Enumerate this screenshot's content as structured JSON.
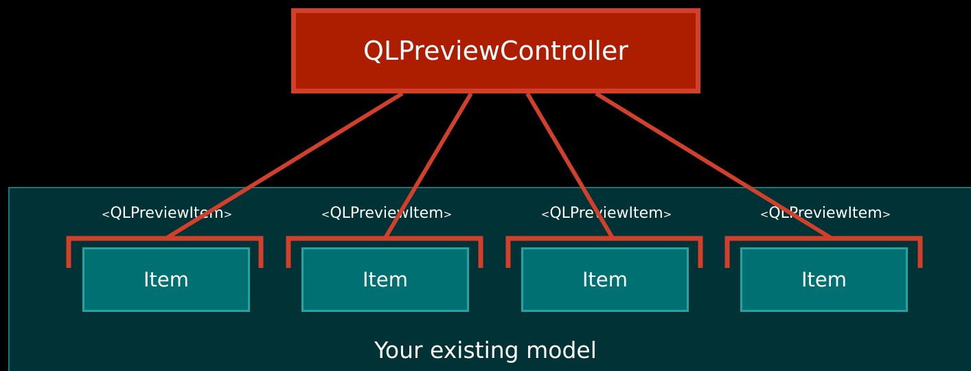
{
  "controller": {
    "label": "QLPreviewController"
  },
  "protocol": {
    "open": "<",
    "name": "QLPreviewItem",
    "close": ">"
  },
  "items": [
    {
      "label": "Item"
    },
    {
      "label": "Item"
    },
    {
      "label": "Item"
    },
    {
      "label": "Item"
    }
  ],
  "model": {
    "label": "Your existing model"
  },
  "colors": {
    "background": "#000000",
    "controller_fill": "#ad1e00",
    "controller_border": "#d2402c",
    "model_panel": "#003236",
    "item_fill": "#007072",
    "item_border": "#27a39f",
    "connector": "#d2402c"
  }
}
